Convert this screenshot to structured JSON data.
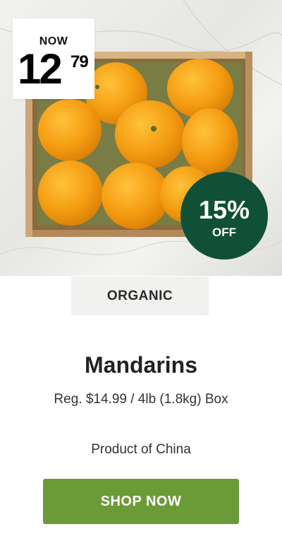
{
  "promo": {
    "price_prefix": "NOW",
    "price_main": "12",
    "price_cents": "79",
    "discount_percent": "15%",
    "discount_suffix": "OFF",
    "tag": "ORGANIC",
    "title": "Mandarins",
    "regular_price_line": "Reg. $14.99 / 4lb (1.8kg) Box",
    "origin": "Product of China",
    "cta_label": "SHOP NOW"
  },
  "colors": {
    "discount_badge": "#0f5037",
    "cta_button": "#6b9b37",
    "tag_background": "#f1f1ef"
  }
}
